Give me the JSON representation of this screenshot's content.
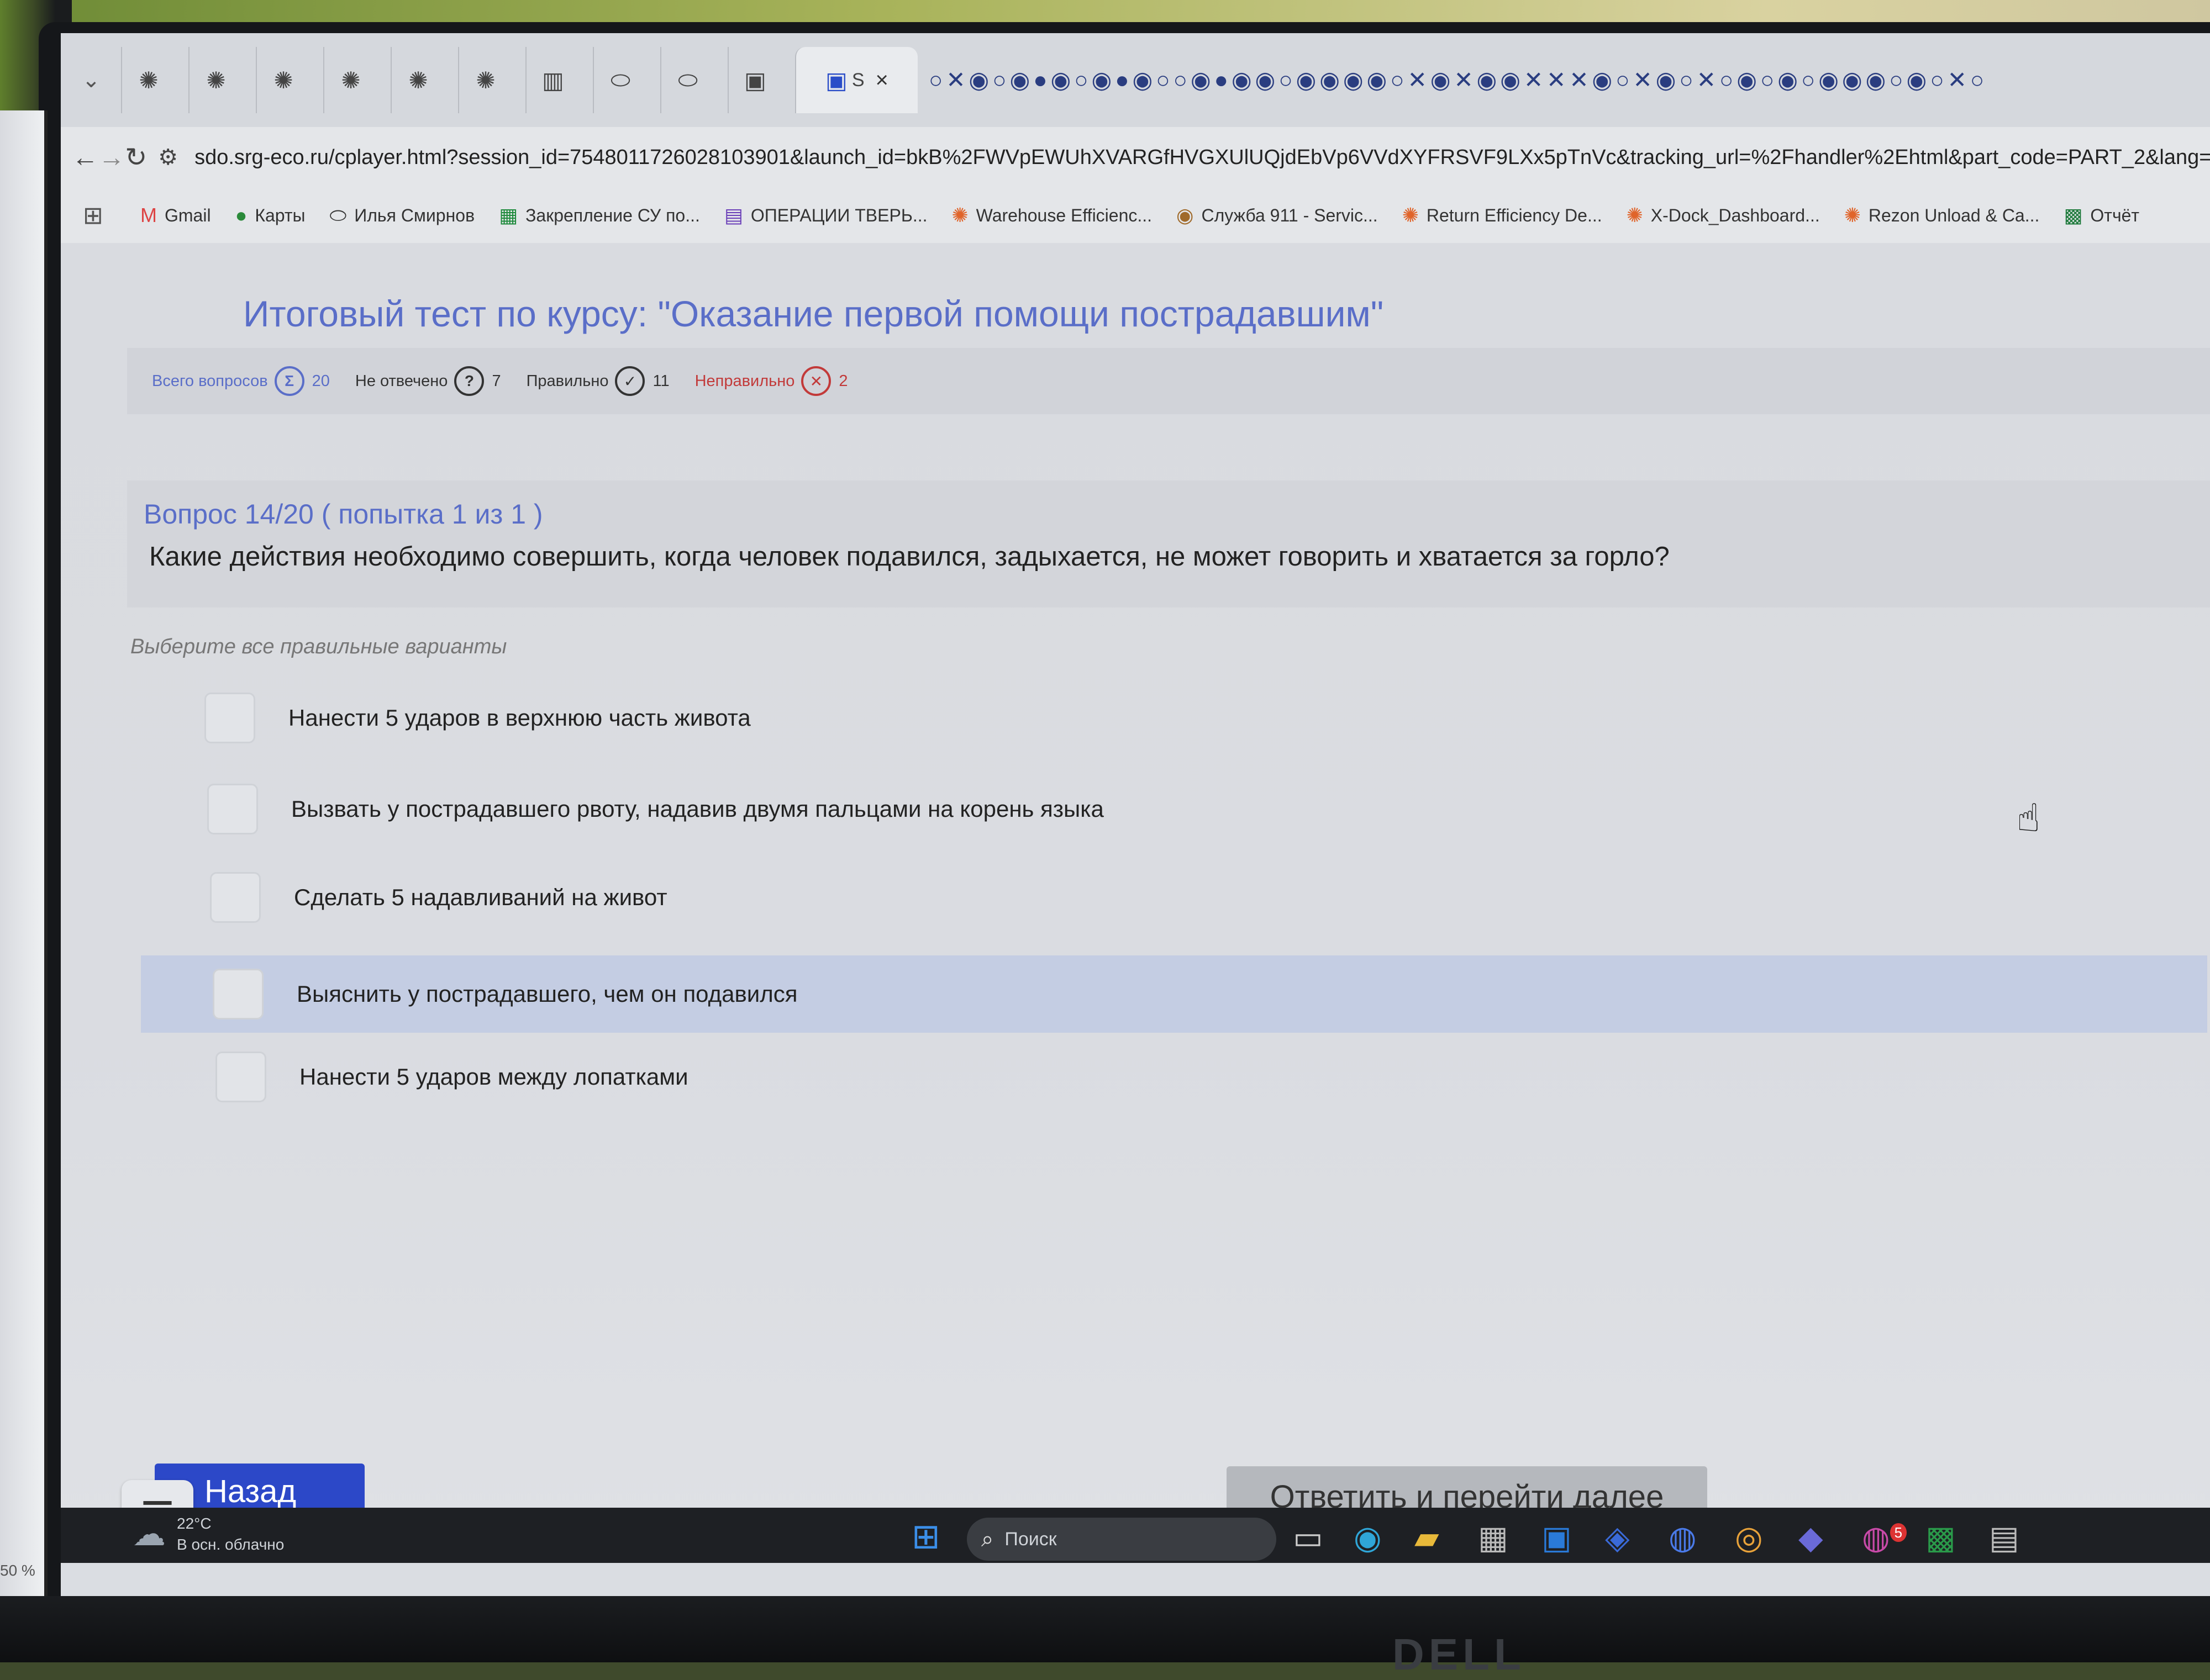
{
  "browser": {
    "tabs": [
      {
        "icon": "grafana-icon"
      },
      {
        "icon": "grafana-icon"
      },
      {
        "icon": "grafana-icon"
      },
      {
        "icon": "grafana-icon"
      },
      {
        "icon": "grafana-icon"
      },
      {
        "icon": "grafana-icon"
      },
      {
        "icon": "chart-icon"
      },
      {
        "icon": "chat-icon"
      },
      {
        "icon": "chat-icon"
      },
      {
        "icon": "outlook-icon"
      },
      {
        "icon": "app-icon"
      }
    ],
    "active_tab": {
      "label": "S",
      "close": "×"
    },
    "extra_tabs_glyphs": "○✕◉○◉●◉○◉●◉○○◉●◉◉○◉◉◉◉○✕◉✕◉◉✕✕✕◉○✕◉○✕○◉○◉○◉◉◉○◉○✕○",
    "url": "sdo.srg-eco.ru/cplayer.html?session_id=7548011726028103901&launch_id=bkB%2FWVpEWUhXVARGfHVGXUlUQjdEbVp6VVdXYFRSVF9LXx5pTnVc&tracking_url=%2Fhandler%2Ehtml&part_code=PART_2&lang=",
    "bookmarks": [
      {
        "label": "Gmail",
        "icon": "gmail-icon"
      },
      {
        "label": "Карты",
        "icon": "maps-pin-icon"
      },
      {
        "label": "Илья Смирнов",
        "icon": "chat-icon"
      },
      {
        "label": "Закрепление СУ по...",
        "icon": "sheets-icon"
      },
      {
        "label": "ОПЕРАЦИИ ТВЕРЬ...",
        "icon": "forms-icon"
      },
      {
        "label": "Warehouse Efficienc...",
        "icon": "grafana-icon"
      },
      {
        "label": "Служба 911 - Servic...",
        "icon": "service-icon"
      },
      {
        "label": "Return Efficiency De...",
        "icon": "grafana-icon"
      },
      {
        "label": "X-Dock_Dashboard...",
        "icon": "grafana-icon"
      },
      {
        "label": "Rezon Unload & Ca...",
        "icon": "grafana-icon"
      },
      {
        "label": "Отчёт",
        "icon": "excel-icon"
      }
    ]
  },
  "test": {
    "title": "Итоговый тест по курсу: \"Оказание первой помощи пострадавшим\"",
    "stats": {
      "total_label": "Всего вопросов",
      "total_icon": "Σ",
      "total_value": "20",
      "unanswered_label": "Не отвечено",
      "unanswered_icon": "?",
      "unanswered_value": "7",
      "correct_label": "Правильно",
      "correct_icon": "✓",
      "correct_value": "11",
      "wrong_label": "Неправильно",
      "wrong_icon": "✕",
      "wrong_value": "2"
    },
    "question_number": "Вопрос 14/20  ( попытка 1 из 1 )",
    "question_text": "Какие действия необходимо совершить, когда человек подавился, задыхается, не может говорить и хватается за горло?",
    "instruction": "Выберите все правильные варианты",
    "options": [
      {
        "label": "Нанести 5 ударов в верхнюю часть живота",
        "checked": false
      },
      {
        "label": "Вызвать у пострадавшего рвоту, надавив двумя пальцами на корень языка",
        "checked": false
      },
      {
        "label": "Сделать 5 надавливаний на живот",
        "checked": false
      },
      {
        "label": "Выяснить у пострадавшего, чем он подавился",
        "checked": false,
        "highlighted": true
      },
      {
        "label": "Нанести 5 ударов между лопатками",
        "checked": false
      }
    ],
    "back_label": "Назад",
    "back_icon": "‹",
    "submit_label": "Ответить и перейти далее"
  },
  "taskbar": {
    "weather_temp": "22°C",
    "weather_desc": "В осн. облачно",
    "search_placeholder": "Поиск",
    "mail_badge": "5"
  },
  "side_monitor": {
    "zoom": "50 %"
  },
  "brand": "DELL",
  "colors": {
    "accent": "#5a6ec8",
    "back_button": "#2c48c8",
    "wrong": "#c23a3a",
    "highlight": "#c4cde3"
  }
}
